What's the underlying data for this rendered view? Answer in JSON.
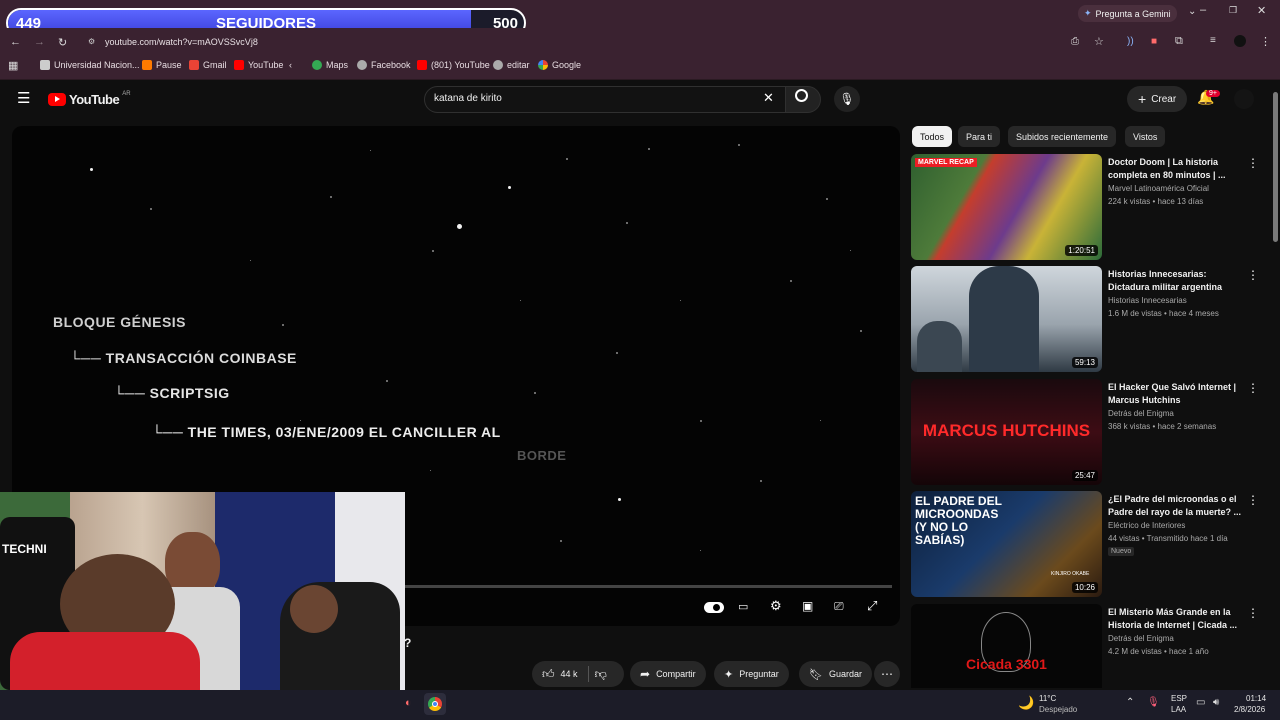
{
  "overlay": {
    "current": "449",
    "title": "SEGUIDORES",
    "goal": "500",
    "progress": 0.898
  },
  "browser": {
    "gemini_button": "Pregunta a Gemini",
    "url": "youtube.com/watch?v=mAOVSSvcVj8",
    "bookmarks": [
      "Universidad Nacion...",
      "Pause",
      "Gmail",
      "YouTube",
      "Maps",
      "Facebook",
      "(801) YouTube",
      "editar",
      "Google"
    ]
  },
  "youtube": {
    "logo_text": "YouTube",
    "region": "AR",
    "search_value": "katana de kirito",
    "create_label": "Crear",
    "notifications": "9+"
  },
  "video": {
    "lines": [
      "BLOQUE GÉNESIS",
      "└── TRANSACCIÓN COINBASE",
      "└── SCRIPTSIG",
      "└── THE TIMES, 03/ENE/2009 EL CANCILLER AL",
      "BORDE"
    ],
    "title_fragment": "?"
  },
  "actions": {
    "likes": "44 k",
    "share": "Compartir",
    "ask": "Preguntar",
    "save": "Guardar"
  },
  "chips": [
    "Todos",
    "Para ti",
    "Subidos recientemente",
    "Vistos"
  ],
  "recommendations": [
    {
      "title": "Doctor Doom | La historia completa en 80 minutos | ...",
      "channel": "Marvel Latinoamérica Oficial",
      "meta": "224 k vistas • hace 13 días",
      "duration": "1:20:51",
      "badge": ""
    },
    {
      "title": "Historias Innecesarias: Dictadura militar argentina",
      "channel": "Historias Innecesarias",
      "meta": "1.6 M de vistas • hace 4 meses",
      "duration": "59:13",
      "badge": ""
    },
    {
      "title": "El Hacker Que Salvó Internet | Marcus Hutchins",
      "channel": "Detrás del Enigma",
      "meta": "368 k vistas • hace 2 semanas",
      "duration": "25:47",
      "badge": ""
    },
    {
      "title": "¿El Padre del microondas o el Padre del rayo de la muerte? ...",
      "channel": "Eléctrico de Interiores",
      "meta": "44 vistas • Transmitido hace 1 día",
      "duration": "10:26",
      "badge": "Nuevo"
    },
    {
      "title": "El Misterio Más Grande en la Historia de Internet | Cicada ...",
      "channel": "Detrás del Enigma",
      "meta": "4.2 M de vistas • hace 1 año",
      "duration": "",
      "badge": ""
    }
  ],
  "thumb_texts": {
    "t1_label": "MARVEL RECAP",
    "t3_label": "MARCUS HUTCHINS",
    "t4_label": "EL PADRE DEL MICROONDAS (Y NO LO SABÍAS)",
    "t4_sub": "KINJIRO OKABE",
    "t5_label": "Cicada 3301"
  },
  "webcam": {
    "chair_text": "TECHNI"
  },
  "taskbar": {
    "temp": "11°C",
    "weather": "Despejado",
    "lang1": "ESP",
    "lang2": "LAA",
    "time": "01:14",
    "date": "2/8/2026"
  },
  "colors": {
    "overlay_fill": "#4b55f0",
    "browser_frame": "#3a2230",
    "youtube_red": "#ff0000"
  }
}
